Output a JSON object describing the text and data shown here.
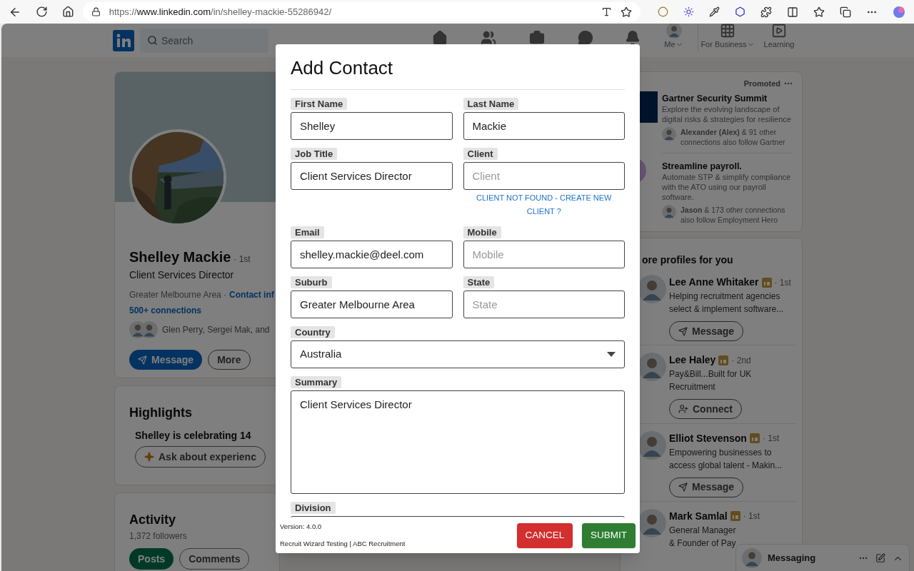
{
  "browser": {
    "url_scheme": "https://",
    "url_host": "www.linkedin.com",
    "url_path": "/in/shelley-mackie-55286942/"
  },
  "nav": {
    "search_placeholder": "Search",
    "me": "Me",
    "business": "For Business",
    "learning": "Learning"
  },
  "profile": {
    "name": "Shelley Mackie",
    "degree": "· 1st",
    "headline": "Client Services Director",
    "location": "Greater Melbourne Area ·",
    "contact": "Contact inf",
    "connections": "500+ connections",
    "mutual": "Glen Perry, Sergei Mak, and",
    "buttons": [
      {
        "kind": "primary",
        "label": "Message"
      },
      {
        "kind": "outline",
        "label": "More"
      }
    ]
  },
  "highlights": {
    "title": "Highlights",
    "text": "Shelley is celebrating 14",
    "button": "Ask about experienc"
  },
  "activity": {
    "title": "Activity",
    "followers": "1,372 followers",
    "tabs": [
      {
        "label": "Posts",
        "selected": true
      },
      {
        "label": "Comments",
        "selected": false
      }
    ]
  },
  "ads": {
    "promoted": "Promoted",
    "items": [
      {
        "title": "Gartner Security Summit",
        "body": "Explore the evolving landscape of digital risks & strategies for resilience",
        "social": "**Alexander (Alex)** & 91 other connections also follow Gartner",
        "kind": "square"
      },
      {
        "title": "Streamline payroll.",
        "body": "Automate STP & simplify compliance with the ATO using our payroll software.",
        "social": "**Jason** & 173 other connections also follow Employment Hero",
        "kind": "circle"
      }
    ]
  },
  "profiles": {
    "title": "ore profiles for you",
    "people": [
      {
        "name": "Lee Anne Whitaker",
        "degree": "· 1st",
        "headline": "Helping recruitment agencies\nselect & implement software...",
        "action": {
          "kind": "message",
          "label": "Message"
        }
      },
      {
        "name": "Lee Haley",
        "degree": "· 2nd",
        "headline": "Pay&Bill...Built for UK\nRecruitment",
        "action": {
          "kind": "connect",
          "label": "Connect"
        }
      },
      {
        "name": "Elliot Stevenson",
        "degree": "· 1st",
        "headline": "Empowering businesses to\naccess global talent - Makin...",
        "action": {
          "kind": "message",
          "label": "Message"
        }
      },
      {
        "name": "Mark Samlal",
        "degree": "· 1st",
        "headline": "General Manager\n& Founder of Pay"
      }
    ]
  },
  "messaging": {
    "title": "Messaging"
  },
  "modal": {
    "title": "Add Contact",
    "fields": [
      {
        "kind": "text",
        "label": "First Name",
        "value": "Shelley"
      },
      {
        "kind": "text",
        "label": "Last Name",
        "value": "Mackie"
      },
      {
        "kind": "text",
        "label": "Job Title",
        "value": "Client Services Director"
      },
      {
        "kind": "text",
        "label": "Client",
        "placeholder": "Client",
        "link": "CLIENT NOT FOUND - CREATE NEW CLIENT ?"
      },
      {
        "kind": "text",
        "label": "Email",
        "value": "shelley.mackie@deel.com"
      },
      {
        "kind": "text",
        "label": "Mobile",
        "placeholder": "Mobile"
      },
      {
        "kind": "text",
        "label": "Suburb",
        "value": "Greater Melbourne Area"
      },
      {
        "kind": "text",
        "label": "State",
        "placeholder": "State"
      },
      {
        "kind": "select",
        "label": "Country",
        "value": "Australia"
      },
      {
        "kind": "textarea",
        "label": "Summary",
        "value": "Client Services Director"
      },
      {
        "kind": "text",
        "label": "Division",
        "wide": true
      }
    ],
    "version": "Version: 4.0.0",
    "org": "Recruit Wizard Testing | ABC Recruitment",
    "buttons": [
      {
        "kind": "cancel",
        "label": "CANCEL"
      },
      {
        "kind": "submit",
        "label": "SUBMIT"
      }
    ]
  }
}
